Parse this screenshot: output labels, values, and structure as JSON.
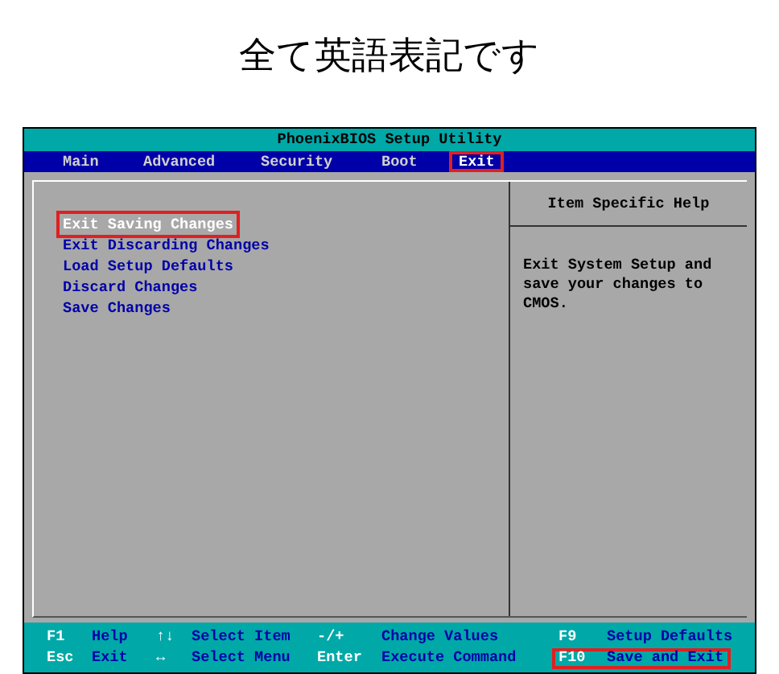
{
  "caption": "全て英語表記です",
  "window": {
    "title": "PhoenixBIOS Setup Utility"
  },
  "tabs": [
    {
      "label": "Main",
      "selected": false,
      "annotated": false
    },
    {
      "label": "Advanced",
      "selected": false,
      "annotated": false
    },
    {
      "label": "Security",
      "selected": false,
      "annotated": false
    },
    {
      "label": "Boot",
      "selected": false,
      "annotated": false
    },
    {
      "label": "Exit",
      "selected": true,
      "annotated": true
    }
  ],
  "items": [
    {
      "label": "Exit Saving Changes",
      "selected": true,
      "annotated": true
    },
    {
      "label": "Exit Discarding Changes",
      "selected": false,
      "annotated": false
    },
    {
      "label": "Load Setup Defaults",
      "selected": false,
      "annotated": false
    },
    {
      "label": "Discard Changes",
      "selected": false,
      "annotated": false
    },
    {
      "label": "Save Changes",
      "selected": false,
      "annotated": false
    }
  ],
  "help": {
    "title": "Item Specific Help",
    "text": "Exit System Setup and save your changes to CMOS."
  },
  "status_bar": [
    [
      {
        "key": "F1",
        "action": "Help",
        "annotated": false
      },
      {
        "key": "↑↓",
        "action": "Select Item",
        "annotated": false
      },
      {
        "key": "-/+",
        "action": "Change Values",
        "annotated": false
      },
      {
        "key": "F9",
        "action": "Setup Defaults",
        "annotated": false
      }
    ],
    [
      {
        "key": "Esc",
        "action": "Exit",
        "annotated": false
      },
      {
        "key": "↔",
        "action": "Select Menu",
        "annotated": false
      },
      {
        "key": "Enter",
        "action": "Execute Command",
        "annotated": false
      },
      {
        "key": "F10",
        "action": "Save and Exit",
        "annotated": true
      }
    ]
  ]
}
